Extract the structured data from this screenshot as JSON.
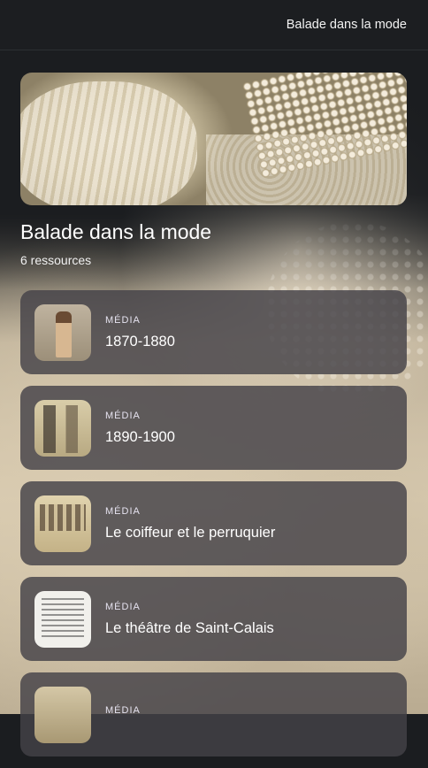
{
  "header": {
    "title": "Balade dans la mode"
  },
  "collection": {
    "title": "Balade dans la mode",
    "count": "6 ressources"
  },
  "items": [
    {
      "type": "MÉDIA",
      "title": "1870-1880"
    },
    {
      "type": "MÉDIA",
      "title": "1890-1900"
    },
    {
      "type": "MÉDIA",
      "title": "Le coiffeur et le perruquier"
    },
    {
      "type": "MÉDIA",
      "title": "Le théâtre de Saint-Calais"
    },
    {
      "type": "MÉDIA",
      "title": ""
    }
  ]
}
